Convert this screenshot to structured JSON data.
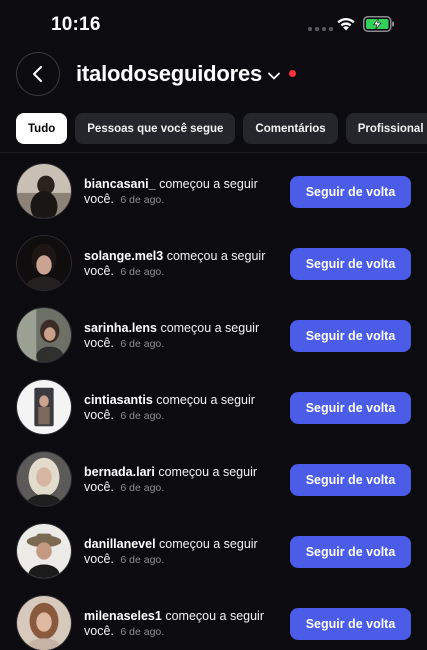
{
  "status_bar": {
    "time": "10:16",
    "icons": [
      "cellular-dots-icon",
      "wifi-icon",
      "battery-charging-icon"
    ],
    "battery_color": "#33d159"
  },
  "header": {
    "back_icon": "chevron-left-icon",
    "account_name": "italodoseguidores",
    "dropdown_icon": "chevron-down-icon",
    "notification_dot_color": "#ff3040"
  },
  "tabs": [
    {
      "label": "Tudo",
      "active": true
    },
    {
      "label": "Pessoas que você segue",
      "active": false
    },
    {
      "label": "Comentários",
      "active": false
    },
    {
      "label": "Profissional",
      "active": false
    }
  ],
  "colors": {
    "background": "#0c0c10",
    "button": "#4a5ce8",
    "muted_text": "#8e8e93"
  },
  "notifications": [
    {
      "username": "biancasani_",
      "action": "começou a seguir você.",
      "time": "6 de ago.",
      "button_label": "Seguir de volta",
      "avatar_icon": "profile-photo"
    },
    {
      "username": "solange.mel3",
      "action": "começou a seguir você.",
      "time": "6 de ago.",
      "button_label": "Seguir de volta",
      "avatar_icon": "profile-photo"
    },
    {
      "username": "sarinha.lens",
      "action": "começou a seguir você.",
      "time": "6 de ago.",
      "button_label": "Seguir de volta",
      "avatar_icon": "profile-photo"
    },
    {
      "username": "cintiasantis",
      "action": "começou a seguir você.",
      "time": "6 de ago.",
      "button_label": "Seguir de volta",
      "avatar_icon": "profile-photo"
    },
    {
      "username": "bernada.lari",
      "action": "começou a seguir você.",
      "time": "6 de ago.",
      "button_label": "Seguir de volta",
      "avatar_icon": "profile-photo"
    },
    {
      "username": "danillanevel",
      "action": "começou a seguir você.",
      "time": "6 de ago.",
      "button_label": "Seguir de volta",
      "avatar_icon": "profile-photo"
    },
    {
      "username": "milenaseles1",
      "action": "começou a seguir você.",
      "time": "6 de ago.",
      "button_label": "Seguir de volta",
      "avatar_icon": "profile-photo"
    }
  ]
}
